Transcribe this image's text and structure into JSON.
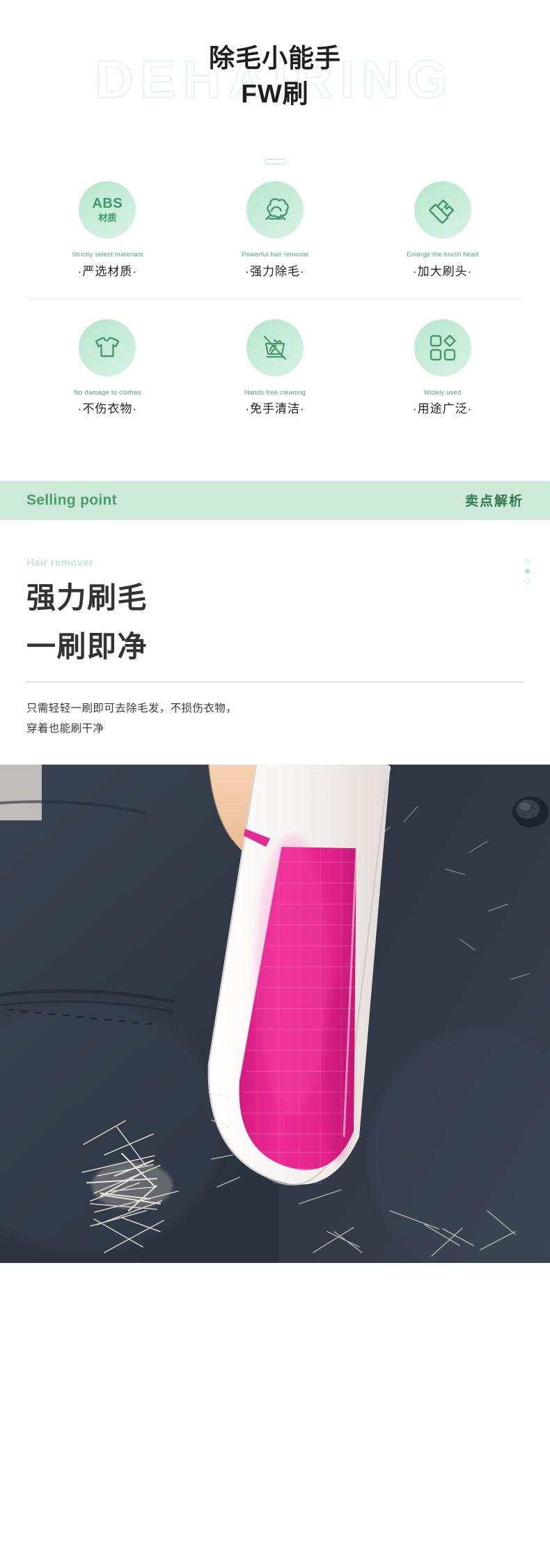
{
  "hero": {
    "watermark": "DEHAIRING",
    "title_line1": "除毛小能手",
    "title_line2": "FW刷"
  },
  "features": {
    "row1": [
      {
        "icon": "abs-material-icon",
        "icon_text_big": "ABS",
        "icon_text_small": "材质",
        "en": "Strictly select materials",
        "cn": "·严选材质·"
      },
      {
        "icon": "lint-ball-icon",
        "en": "Powerful hair removal",
        "cn": "·强力除毛·"
      },
      {
        "icon": "brush-head-icon",
        "en": "Enlarge the brush head",
        "cn": "·加大刷头·"
      }
    ],
    "row2": [
      {
        "icon": "tshirt-icon",
        "en": "No damage to clothes",
        "cn": "·不伤衣物·"
      },
      {
        "icon": "no-hand-wash-icon",
        "en": "Hands free cleaning",
        "cn": "·免手清洁·"
      },
      {
        "icon": "four-shapes-icon",
        "en": "Widely used",
        "cn": "·用途广泛·"
      }
    ]
  },
  "banner": {
    "en": "Selling point",
    "cn": "卖点解析"
  },
  "selling": {
    "eyebrow": "Hair remover",
    "heading_line1": "强力刷毛",
    "heading_line2": "一刷即净",
    "body_line1": "只需轻轻一刷即可去除毛发，不损伤衣物，",
    "body_line2": "穿着也能刷干净"
  },
  "photo": {
    "alt": "手持粉色除毛刷在深色毛呢衣物上刷除白色毛絮",
    "colors": {
      "fabric_dark": "#2f3744",
      "fabric_light": "#4a5361",
      "brush_pink": "#e5218c",
      "brush_white": "#f7f4f2",
      "skin": "#f0c6a4",
      "lint_white": "#efe9df"
    }
  },
  "theme": {
    "green_accent": "#4cab79",
    "green_deep": "#2f7a50",
    "green_banner_bg": "#cde9d7",
    "green_pale": "#c3e7d2",
    "text_dark": "#222222"
  }
}
